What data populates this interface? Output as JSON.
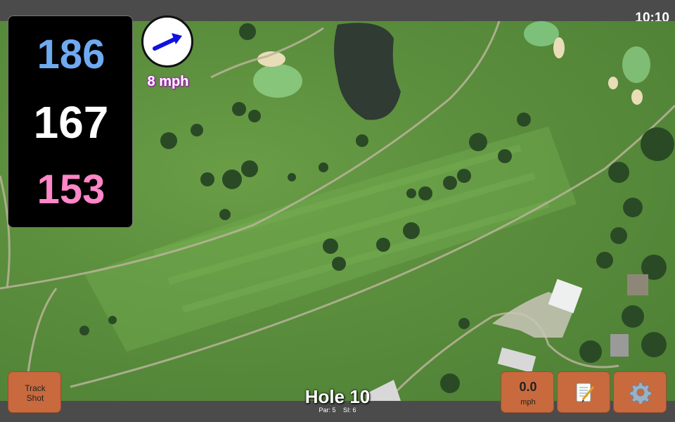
{
  "status": {
    "time": "10:10"
  },
  "yardage": {
    "back": "186",
    "middle": "167",
    "front": "153"
  },
  "wind": {
    "speed_label": "8 mph",
    "arrow_icon": "wind-direction-arrow-icon",
    "direction": "blowing right-up"
  },
  "hole": {
    "title": "Hole 10",
    "par": "Par: 5",
    "si": "SI: 6"
  },
  "buttons": {
    "track_shot_line1": "Track",
    "track_shot_line2": "Shot",
    "wind_value": "0.0",
    "wind_unit": "mph",
    "notes_icon": "notepad-icon",
    "settings_icon": "gear-icon"
  },
  "colors": {
    "back": "#6eaaf0",
    "middle": "#ffffff",
    "front": "#ff86c8",
    "button": "#c86a3e",
    "wind_text_glow": "#b020c8"
  }
}
